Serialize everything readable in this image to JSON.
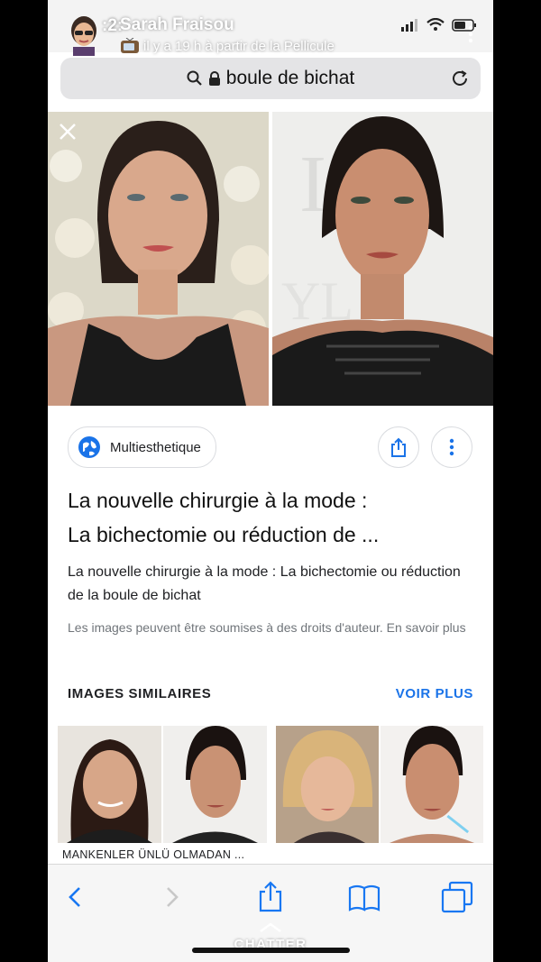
{
  "status": {
    "time": ":2:",
    "user": "Sarah Fraisou",
    "subtitle": "il y a 19 h à partir de la Pellicule"
  },
  "browser": {
    "url": "boule de bichat"
  },
  "result": {
    "source": "Multiesthetique",
    "title_line1": "La nouvelle chirurgie à la mode :",
    "title_line2": "La bichectomie ou réduction de ...",
    "description": "La nouvelle chirurgie à la mode : La bichectomie ou réduction de la boule de bichat",
    "rights": "Les images peuvent être soumises à des droits d'auteur. En savoir plus"
  },
  "similar": {
    "heading": "IMAGES SIMILAIRES",
    "more_label": "VOIR PLUS",
    "items": [
      {
        "caption": "MANKENLER ÜNLÜ OLMADAN ..."
      },
      {
        "caption": ""
      }
    ]
  },
  "bottom": {
    "chatter": "CHATTER"
  },
  "colors": {
    "link_blue": "#1a73e8",
    "ios_blue": "#1877f2"
  }
}
